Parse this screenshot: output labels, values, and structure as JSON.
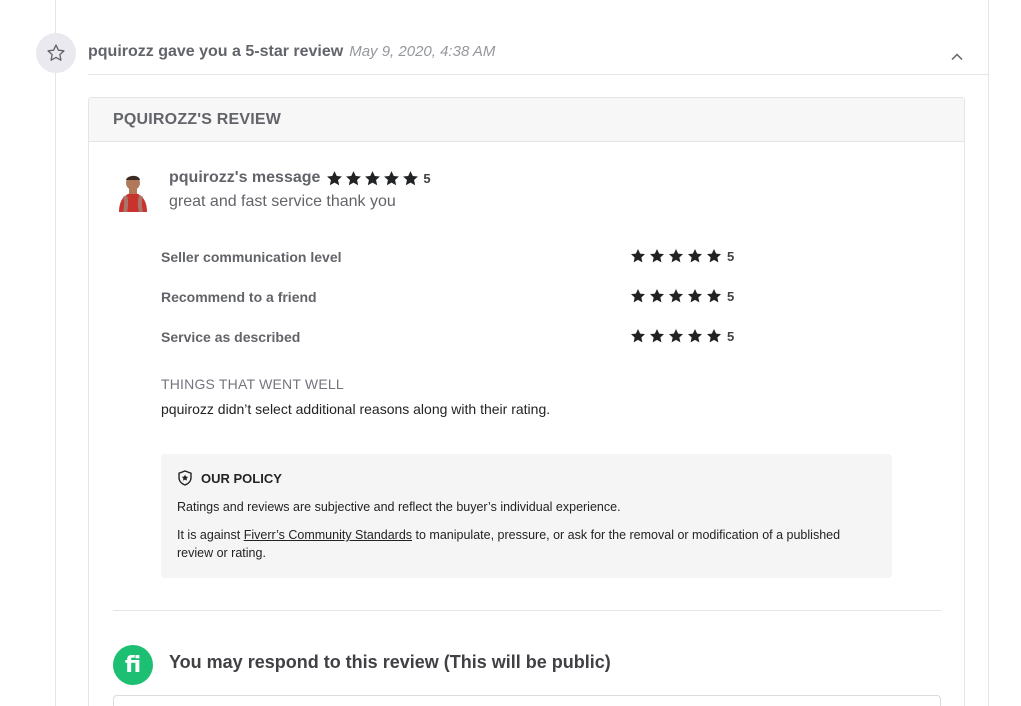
{
  "event": {
    "title": "pquirozz gave you a 5-star review",
    "timestamp": "May 9, 2020, 4:38 AM",
    "icon": "star-outline-icon"
  },
  "review": {
    "header": "PQUIROZZ'S REVIEW",
    "author_label": "pquirozz's message",
    "overall_rating": "5",
    "message": "great and fast service thank you",
    "criteria": [
      {
        "label": "Seller communication level",
        "rating": "5"
      },
      {
        "label": "Recommend to a friend",
        "rating": "5"
      },
      {
        "label": "Service as described",
        "rating": "5"
      }
    ],
    "went_well_title": "THINGS THAT WENT WELL",
    "went_well_text": "pquirozz didn’t select additional reasons along with their rating."
  },
  "policy": {
    "title": "OUR POLICY",
    "p1": "Ratings and reviews are subjective and reflect the buyer’s individual experience.",
    "p2_before": "It is against ",
    "p2_link": "Fiverr’s Community Standards",
    "p2_after": " to manipulate, pressure, or ask for the removal or modification of a published review or rating."
  },
  "respond": {
    "logo_text": "fi",
    "title": "You may respond to this review (This will be public)"
  },
  "colors": {
    "accent_green": "#1dbf73",
    "star": "#222325"
  }
}
